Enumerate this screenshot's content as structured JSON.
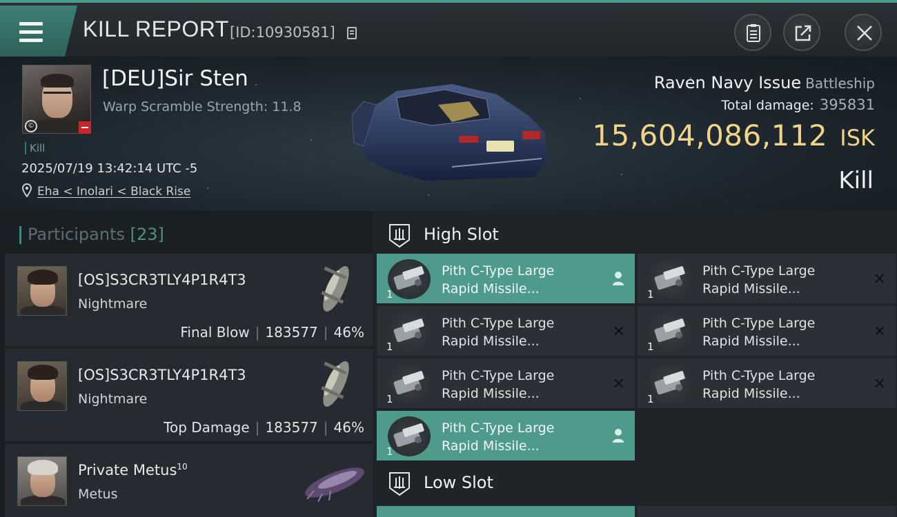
{
  "topbar": {
    "title": "KILL REPORT",
    "report_id": "[ID:10930581]",
    "menu_icon": "hamburger-icon",
    "buttons": [
      "clipboard-icon",
      "share-icon",
      "close-icon"
    ],
    "accent_color": "#4a9d90"
  },
  "victim": {
    "name": "[DEU]Sir Sten",
    "warp_scramble": "Warp Scramble Strength: 11.8",
    "tag": "Kill",
    "datetime": "2025/07/19 13:42:14 UTC -5",
    "location": "Eha < Inolari < Black Rise"
  },
  "ship": {
    "name": "Raven Navy Issue",
    "class": "Battleship",
    "damage_label": "Total damage:",
    "damage_value": "395831",
    "isk_value": "15,604,086,112",
    "isk_unit": "ISK",
    "result": "Kill",
    "isk_color": "#f0d48a"
  },
  "participants": {
    "label": "Participants",
    "count": "[23]",
    "items": [
      {
        "name": "[OS]S3CR3TLY4P1R4T3",
        "ship": "Nightmare",
        "role": "Final Blow",
        "damage": "183577",
        "percent": "46%"
      },
      {
        "name": "[OS]S3CR3TLY4P1R4T3",
        "ship": "Nightmare",
        "role": "Top Damage",
        "damage": "183577",
        "percent": "46%"
      },
      {
        "name": "Private Metus",
        "name_sup": "10",
        "ship": "Metus"
      }
    ]
  },
  "slots": {
    "high_label": "High Slot",
    "low_label": "Low Slot",
    "modules": [
      {
        "line1": "Pith C-Type Large",
        "line2": "Rapid Missile...",
        "qty": "1",
        "status": "dropped"
      },
      {
        "line1": "Pith C-Type Large",
        "line2": "Rapid Missile...",
        "qty": "1",
        "status": "destroyed"
      },
      {
        "line1": "Pith C-Type Large",
        "line2": "Rapid Missile...",
        "qty": "1",
        "status": "destroyed"
      },
      {
        "line1": "Pith C-Type Large",
        "line2": "Rapid Missile...",
        "qty": "1",
        "status": "destroyed"
      },
      {
        "line1": "Pith C-Type Large",
        "line2": "Rapid Missile...",
        "qty": "1",
        "status": "destroyed"
      },
      {
        "line1": "Pith C-Type Large",
        "line2": "Rapid Missile...",
        "qty": "1",
        "status": "destroyed"
      },
      {
        "line1": "Pith C-Type Large",
        "line2": "Rapid Missile...",
        "qty": "1",
        "status": "dropped"
      }
    ]
  }
}
